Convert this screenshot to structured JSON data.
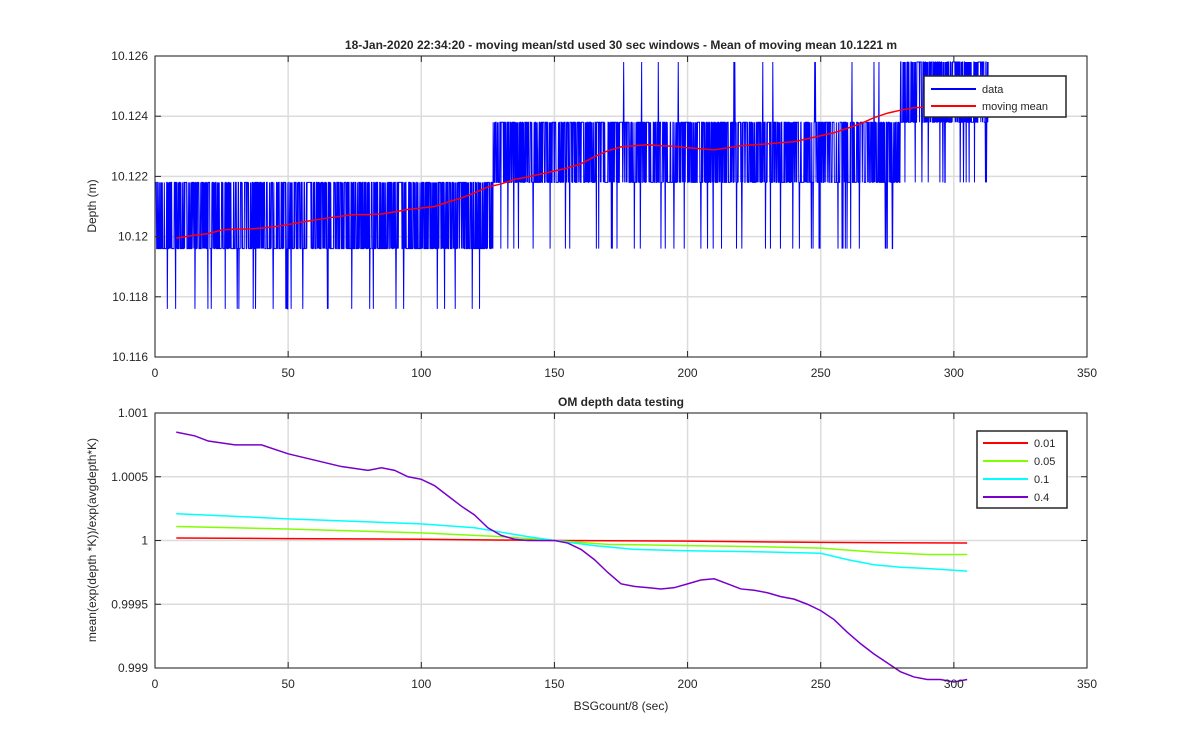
{
  "chart_data": [
    {
      "type": "line",
      "title": "18-Jan-2020 22:34:20 - moving mean/std used 30 sec windows - Mean of moving mean 10.1221 m",
      "xlabel": "",
      "ylabel": "Depth (m)",
      "xlim": [
        0,
        350
      ],
      "ylim": [
        10.116,
        10.126
      ],
      "xticks": [
        0,
        50,
        100,
        150,
        200,
        250,
        300,
        350
      ],
      "yticks": [
        10.116,
        10.118,
        10.12,
        10.122,
        10.124,
        10.126
      ],
      "xtick_labels": [
        "0",
        "50",
        "100",
        "150",
        "200",
        "250",
        "300",
        "350"
      ],
      "ytick_labels": [
        "10.116",
        "10.118",
        "10.12",
        "10.122",
        "10.124",
        "10.126"
      ],
      "grid": true,
      "legend_position": "top-right",
      "data_range_x": [
        0,
        313
      ],
      "quantization_levels": [
        10.1176,
        10.1196,
        10.1218,
        10.1238,
        10.1258
      ],
      "series": [
        {
          "name": "data",
          "color": "#0000ff",
          "segments": [
            {
              "x": [
                0,
                10
              ],
              "typical": [
                10.1196,
                10.1218
              ],
              "spike_down": 10.1176
            },
            {
              "x": [
                10,
                40
              ],
              "typical": [
                10.1196,
                10.1218
              ],
              "spike_down": 10.1176
            },
            {
              "x": [
                40,
                127
              ],
              "typical": [
                10.1196,
                10.1218
              ],
              "spike_down": 10.1176
            },
            {
              "x": [
                127,
                165
              ],
              "typical": [
                10.1218,
                10.1238
              ],
              "spike_down": 10.1196
            },
            {
              "x": [
                165,
                280
              ],
              "typical": [
                10.1218,
                10.1238
              ],
              "spike_down": 10.1196,
              "spike_up": 10.1258
            },
            {
              "x": [
                280,
                313
              ],
              "typical": [
                10.1238,
                10.1258
              ],
              "spike_down": 10.1218
            }
          ]
        },
        {
          "name": "moving mean",
          "color": "#ff0000",
          "x": [
            8,
            15,
            20,
            25,
            30,
            35,
            40,
            45,
            50,
            55,
            60,
            65,
            70,
            75,
            80,
            85,
            90,
            95,
            100,
            105,
            110,
            115,
            120,
            125,
            130,
            135,
            140,
            145,
            150,
            155,
            160,
            165,
            170,
            175,
            180,
            185,
            190,
            195,
            200,
            205,
            210,
            215,
            220,
            225,
            230,
            235,
            240,
            245,
            250,
            255,
            260,
            265,
            270,
            275,
            280,
            285,
            290,
            295,
            298
          ],
          "y": [
            10.11995,
            10.12005,
            10.1201,
            10.12022,
            10.12025,
            10.12025,
            10.12028,
            10.12033,
            10.1204,
            10.12048,
            10.12055,
            10.12062,
            10.12068,
            10.12073,
            10.12073,
            10.12075,
            10.12082,
            10.1209,
            10.12095,
            10.121,
            10.12115,
            10.12128,
            10.12145,
            10.12165,
            10.12175,
            10.1219,
            10.12198,
            10.12208,
            10.12218,
            10.12228,
            10.12242,
            10.12265,
            10.12285,
            10.12298,
            10.12302,
            10.12305,
            10.12302,
            10.123,
            10.12295,
            10.12292,
            10.12288,
            10.12295,
            10.12302,
            10.12305,
            10.12308,
            10.12312,
            10.12315,
            10.12325,
            10.12335,
            10.12345,
            10.1236,
            10.12375,
            10.12395,
            10.1241,
            10.1242,
            10.12428,
            10.1243,
            10.1243,
            10.1243
          ]
        }
      ]
    },
    {
      "type": "line",
      "title": "OM depth data testing",
      "xlabel": "BSGcount/8 (sec)",
      "ylabel": "mean(exp(depth *K))/exp(avgdepth*K)",
      "xlim": [
        0,
        350
      ],
      "ylim": [
        0.999,
        1.001
      ],
      "xticks": [
        0,
        50,
        100,
        150,
        200,
        250,
        300,
        350
      ],
      "yticks": [
        0.999,
        0.9995,
        1,
        1.0005,
        1.001
      ],
      "xtick_labels": [
        "0",
        "50",
        "100",
        "150",
        "200",
        "250",
        "300",
        "350"
      ],
      "ytick_labels": [
        "0.999",
        "0.9995",
        "1",
        "1.0005",
        "1.001"
      ],
      "grid": true,
      "legend_position": "top-right",
      "series": [
        {
          "name": "0.01",
          "color": "#ff0000",
          "x": [
            8,
            50,
            100,
            150,
            200,
            250,
            305
          ],
          "y": [
            1.00002,
            1.000015,
            1.00001,
            1.0,
            0.999995,
            0.999985,
            0.99998
          ]
        },
        {
          "name": "0.05",
          "color": "#80ff00",
          "x": [
            8,
            50,
            100,
            130,
            150,
            170,
            200,
            230,
            250,
            270,
            290,
            305
          ],
          "y": [
            1.00011,
            1.00009,
            1.00006,
            1.00003,
            1.0,
            0.99997,
            0.99996,
            0.99995,
            0.99994,
            0.99991,
            0.99989,
            0.99989
          ]
        },
        {
          "name": "0.1",
          "color": "#00ffff",
          "x": [
            8,
            50,
            100,
            120,
            140,
            150,
            165,
            180,
            200,
            230,
            250,
            260,
            270,
            280,
            290,
            305
          ],
          "y": [
            1.00021,
            1.00017,
            1.00013,
            1.0001,
            1.00003,
            1.0,
            0.99996,
            0.99993,
            0.99992,
            0.99991,
            0.9999,
            0.99985,
            0.99981,
            0.99979,
            0.99978,
            0.99976
          ]
        },
        {
          "name": "0.4",
          "color": "#7700cc",
          "x": [
            8,
            15,
            20,
            30,
            40,
            50,
            60,
            70,
            80,
            85,
            90,
            95,
            100,
            105,
            110,
            115,
            120,
            125,
            130,
            135,
            140,
            145,
            150,
            155,
            160,
            165,
            170,
            175,
            180,
            185,
            190,
            195,
            200,
            205,
            210,
            215,
            220,
            225,
            230,
            235,
            240,
            245,
            250,
            255,
            260,
            265,
            270,
            275,
            280,
            285,
            290,
            295,
            300,
            305
          ],
          "y": [
            1.00085,
            1.00082,
            1.00078,
            1.00075,
            1.00075,
            1.00068,
            1.00063,
            1.00058,
            1.00055,
            1.00057,
            1.00055,
            1.0005,
            1.00048,
            1.00043,
            1.00035,
            1.00027,
            1.0002,
            1.0001,
            1.00004,
            1.00001,
            1.0,
            1.0,
            1.0,
            0.99998,
            0.99993,
            0.99985,
            0.99975,
            0.99966,
            0.99964,
            0.99963,
            0.99962,
            0.99963,
            0.99966,
            0.99969,
            0.9997,
            0.99966,
            0.99962,
            0.99961,
            0.99959,
            0.99956,
            0.99954,
            0.9995,
            0.99945,
            0.99938,
            0.99928,
            0.99919,
            0.99911,
            0.99904,
            0.99897,
            0.99893,
            0.99891,
            0.99891,
            0.99889,
            0.99891
          ]
        }
      ]
    }
  ]
}
